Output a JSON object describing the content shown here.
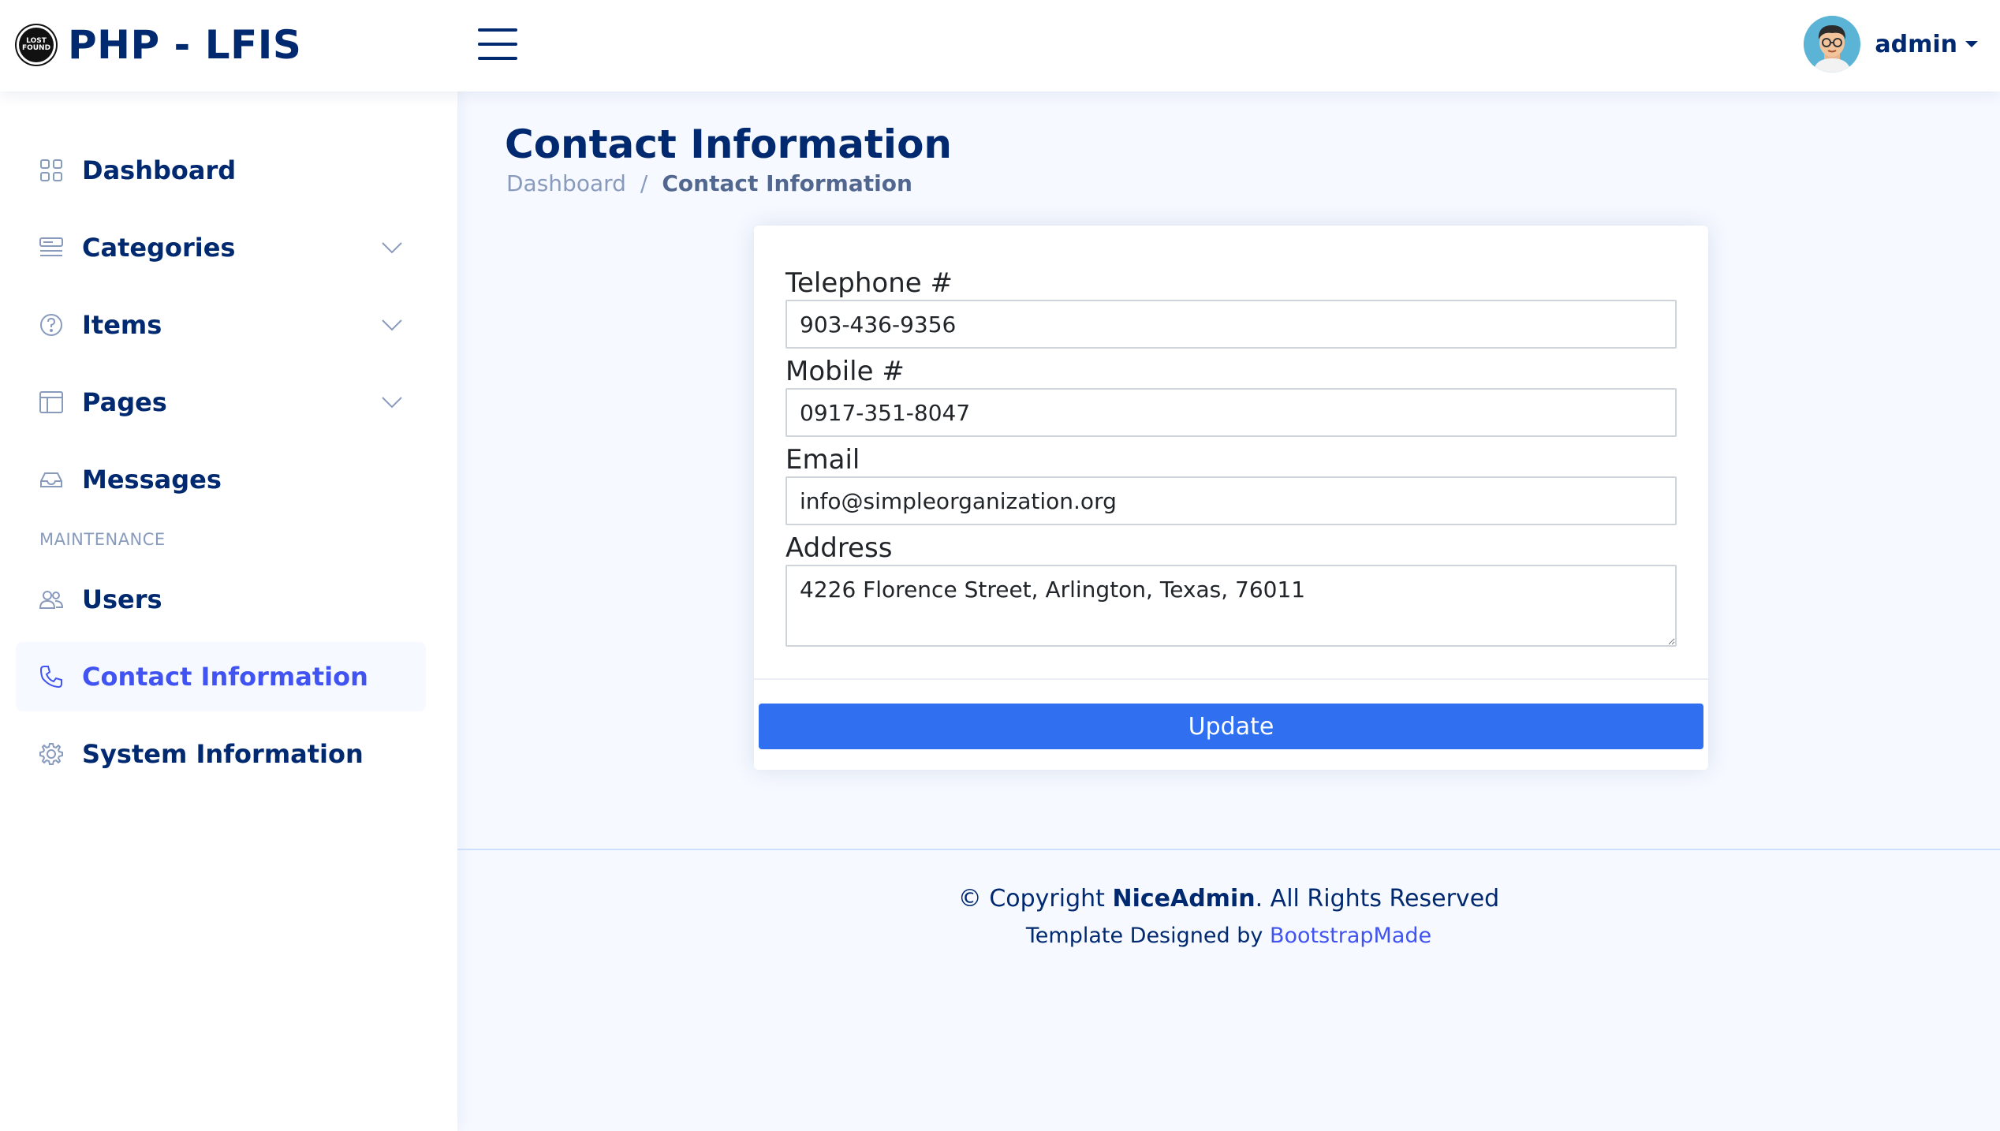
{
  "header": {
    "logo_badge_text": "LOST FOUND",
    "app_title": "PHP - LFIS",
    "profile_name": "admin"
  },
  "sidebar": {
    "items": [
      {
        "label": "Dashboard",
        "icon": "grid-icon",
        "has_chevron": false
      },
      {
        "label": "Categories",
        "icon": "menu-button-icon",
        "has_chevron": true
      },
      {
        "label": "Items",
        "icon": "question-circle-icon",
        "has_chevron": true
      },
      {
        "label": "Pages",
        "icon": "layout-icon",
        "has_chevron": true
      },
      {
        "label": "Messages",
        "icon": "inbox-icon",
        "has_chevron": false
      }
    ],
    "heading": "MAINTENANCE",
    "maintenance_items": [
      {
        "label": "Users",
        "icon": "people-icon"
      },
      {
        "label": "Contact Information",
        "icon": "telephone-icon",
        "active": true
      },
      {
        "label": "System Information",
        "icon": "gear-icon"
      }
    ]
  },
  "main": {
    "page_title": "Contact Information",
    "breadcrumb": {
      "home": "Dashboard",
      "separator": "/",
      "current": "Contact Information"
    },
    "form": {
      "telephone_label": "Telephone #",
      "telephone_value": "903-436-9356",
      "mobile_label": "Mobile #",
      "mobile_value": "0917-351-8047",
      "email_label": "Email",
      "email_value": "info@simpleorganization.org",
      "address_label": "Address",
      "address_value": "4226 Florence Street, Arlington, Texas, 76011",
      "submit_label": "Update"
    }
  },
  "footer": {
    "copyright_prefix": "© Copyright",
    "copyright_brand": "NiceAdmin",
    "copyright_suffix": ". All Rights Reserved",
    "credits_prefix": "Template Designed by",
    "credits_link": "BootstrapMade"
  },
  "colors": {
    "primary_text": "#012970",
    "accent": "#4154f1",
    "button": "#2f6ff0",
    "background": "#f6f9ff"
  }
}
